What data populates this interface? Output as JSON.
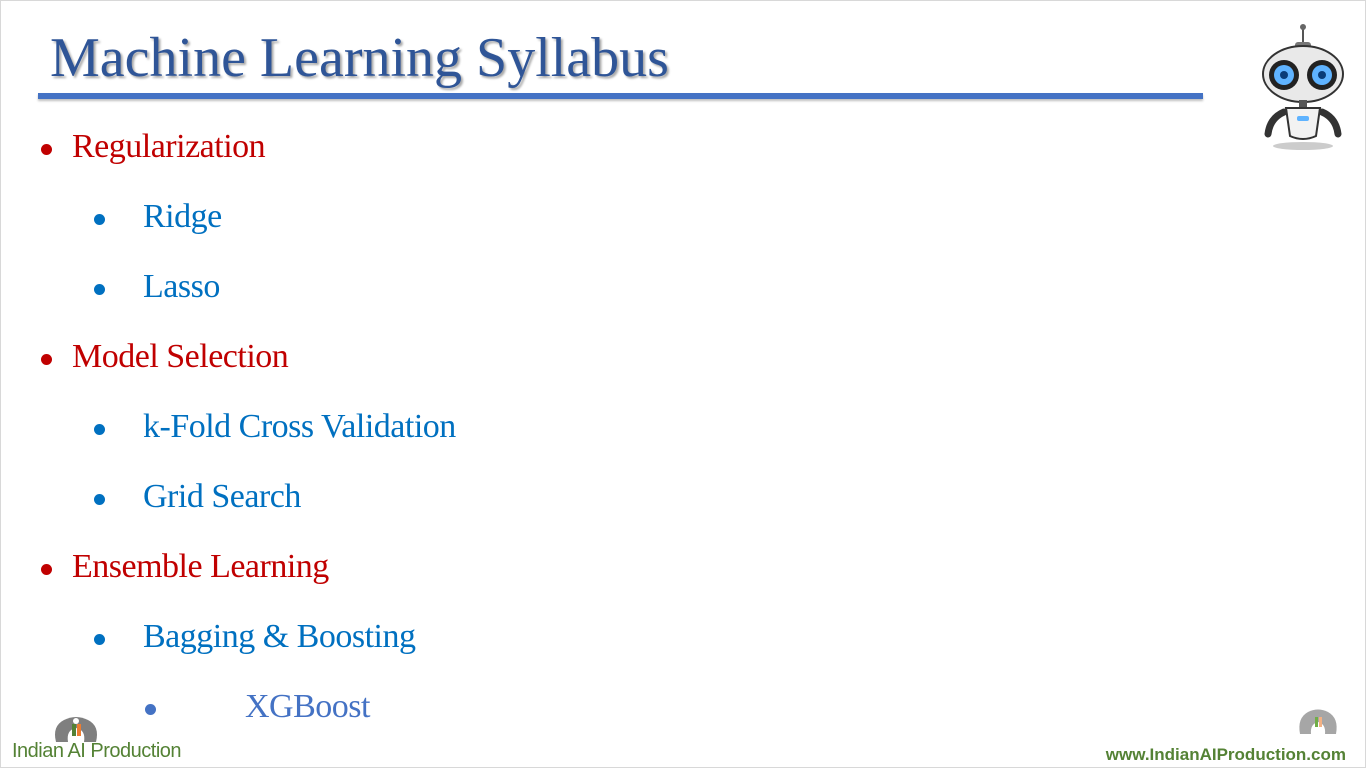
{
  "slide": {
    "title": "Machine Learning Syllabus",
    "bullets": [
      {
        "text": "Regularization",
        "level": 1
      },
      {
        "text": "Ridge",
        "level": 2
      },
      {
        "text": "Lasso",
        "level": 2
      },
      {
        "text": "Model Selection",
        "level": 1
      },
      {
        "text": "k-Fold Cross Validation",
        "level": 2
      },
      {
        "text": "Grid Search",
        "level": 2
      },
      {
        "text": "Ensemble Learning",
        "level": 1
      },
      {
        "text": "Bagging & Boosting",
        "level": 2
      },
      {
        "text": "XGBoost",
        "level": 3
      }
    ]
  },
  "branding": {
    "name": "Indian AI Production",
    "url": "www.IndianAIProduction.com"
  },
  "colors": {
    "title": "#2f5597",
    "rule": "#4472c4",
    "level1": "#c00000",
    "level2": "#0070c0",
    "level3": "#4472c4",
    "brand": "#548235"
  }
}
